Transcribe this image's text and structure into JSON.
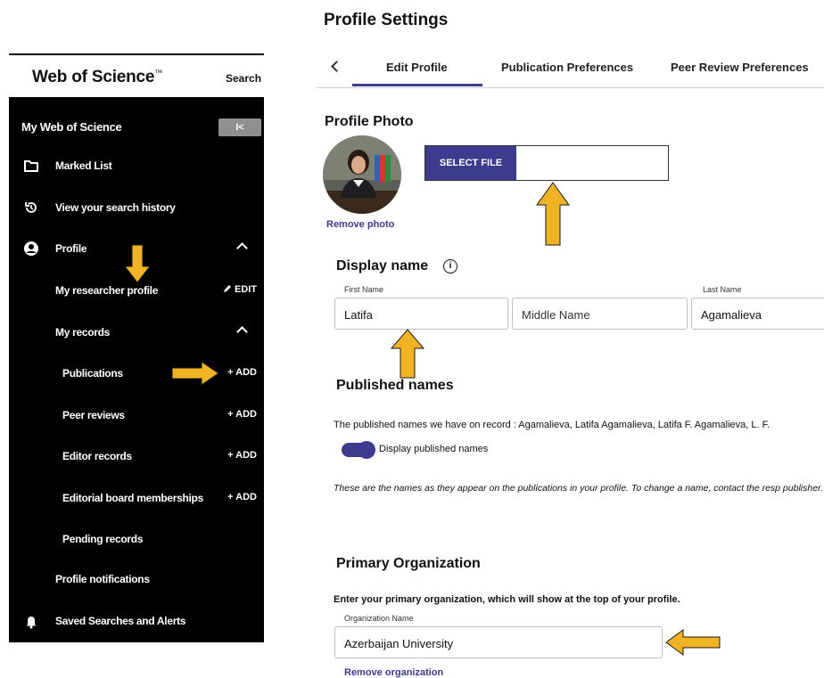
{
  "sidebar": {
    "logo": "Web of Science",
    "logo_mark": "™",
    "search_label": "Search",
    "title": "My Web of Science",
    "collapse_label": "I<",
    "items": [
      {
        "label": "Marked List",
        "icon": "folder-icon"
      },
      {
        "label": "View your search history",
        "icon": "history-icon"
      },
      {
        "label": "Profile",
        "icon": "user-circle-icon"
      },
      {
        "label": "My researcher profile",
        "action": "EDIT",
        "icon": "pencil-icon"
      },
      {
        "label": "My records"
      },
      {
        "label": "Publications",
        "action": "+ ADD"
      },
      {
        "label": "Peer reviews",
        "action": "+ ADD"
      },
      {
        "label": "Editor records",
        "action": "+ ADD"
      },
      {
        "label": "Editorial board memberships",
        "action": "+ ADD"
      },
      {
        "label": "Pending records"
      },
      {
        "label": "Profile notifications"
      },
      {
        "label": "Saved Searches and Alerts",
        "icon": "bell-icon"
      }
    ]
  },
  "main": {
    "title": "Profile Settings",
    "tabs": [
      "Edit Profile",
      "Publication Preferences",
      "Peer Review Preferences"
    ],
    "active_tab": "Edit Profile",
    "photo": {
      "heading": "Profile Photo",
      "select_file": "SELECT FILE",
      "remove": "Remove photo"
    },
    "display_name": {
      "heading": "Display name",
      "first_label": "First Name",
      "first_value": "Latifa",
      "middle_placeholder": "Middle Name",
      "last_label": "Last Name",
      "last_value": "Agamalieva"
    },
    "published_names": {
      "heading": "Published names",
      "line": "The published names we have on record :  Agamalieva, Latifa   Agamalieva, Latifa F.   Agamalieva, L. F.",
      "toggle_label": "Display published names",
      "toggle_on": true,
      "note": "These are the names as they appear on the publications in your profile. To change a name, contact the resp publisher."
    },
    "organization": {
      "heading": "Primary Organization",
      "desc": "Enter your primary organization, which will show at the top of your profile.",
      "field_label": "Organization Name",
      "value": "Azerbaijan University",
      "remove": "Remove organization"
    }
  },
  "colors": {
    "accent": "#3d3b8e",
    "arrow_fill": "#f0b323",
    "arrow_stroke": "#1a1a1a",
    "sidebar_bg": "#000000"
  }
}
